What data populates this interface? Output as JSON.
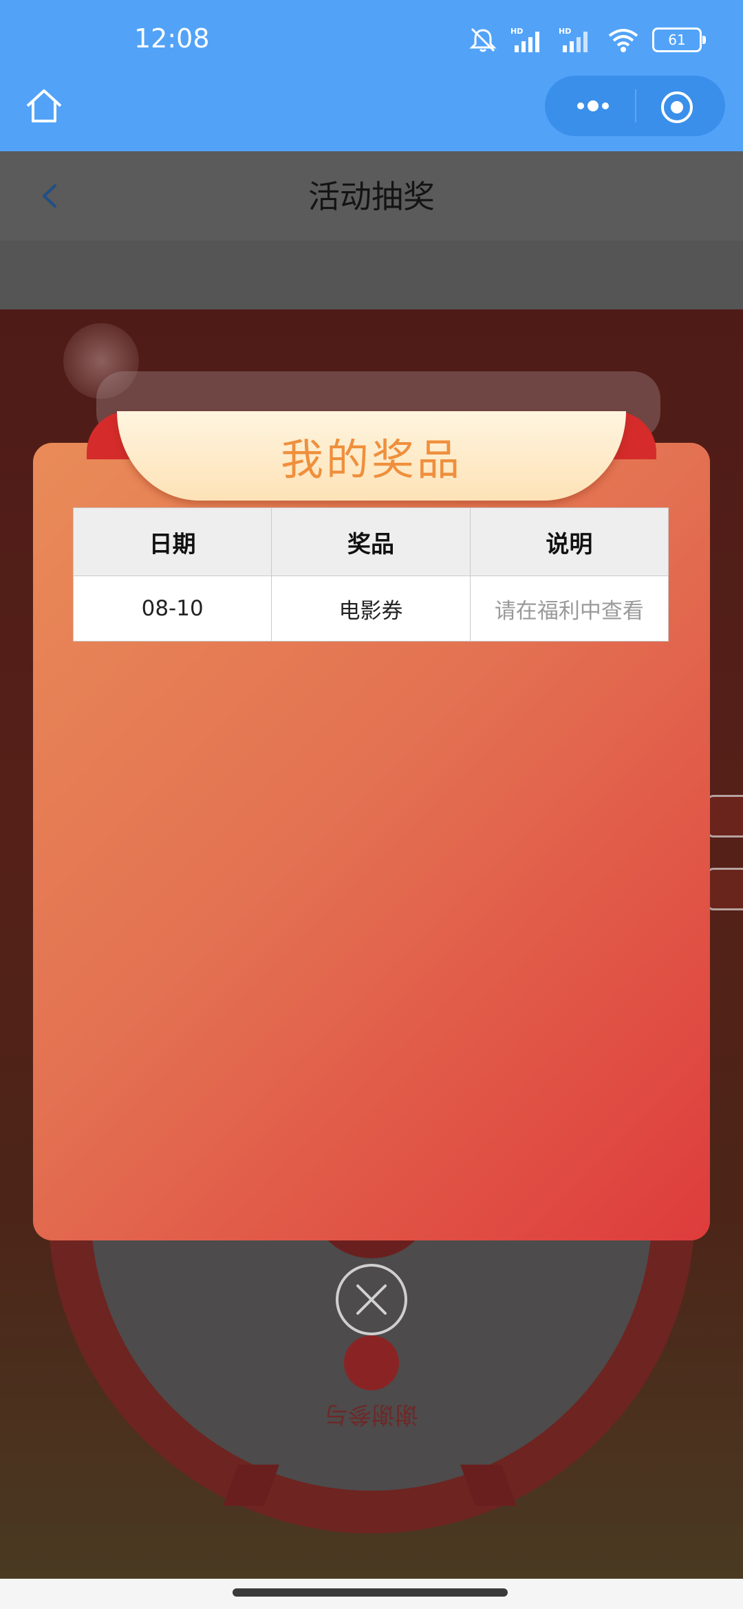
{
  "status_bar": {
    "time": "12:08",
    "battery": "61",
    "icons": [
      "mute-icon",
      "signal-hd-icon",
      "signal-hd-icon",
      "wifi-icon",
      "battery-icon"
    ]
  },
  "mini_program_header": {
    "icons": [
      "home-icon",
      "more-icon",
      "target-icon"
    ]
  },
  "page": {
    "title": "活动抽奖",
    "lottery_text": "谢谢参与"
  },
  "modal": {
    "title": "我的奖品",
    "table": {
      "headers": [
        "日期",
        "奖品",
        "说明"
      ],
      "rows": [
        [
          "08-10",
          "电影券",
          "请在福利中查看"
        ]
      ]
    }
  },
  "colors": {
    "header_blue": "#52a3f8",
    "modal_orange": "#e98b58",
    "modal_red": "#de3c3c",
    "title_orange": "#ef8f3c"
  }
}
